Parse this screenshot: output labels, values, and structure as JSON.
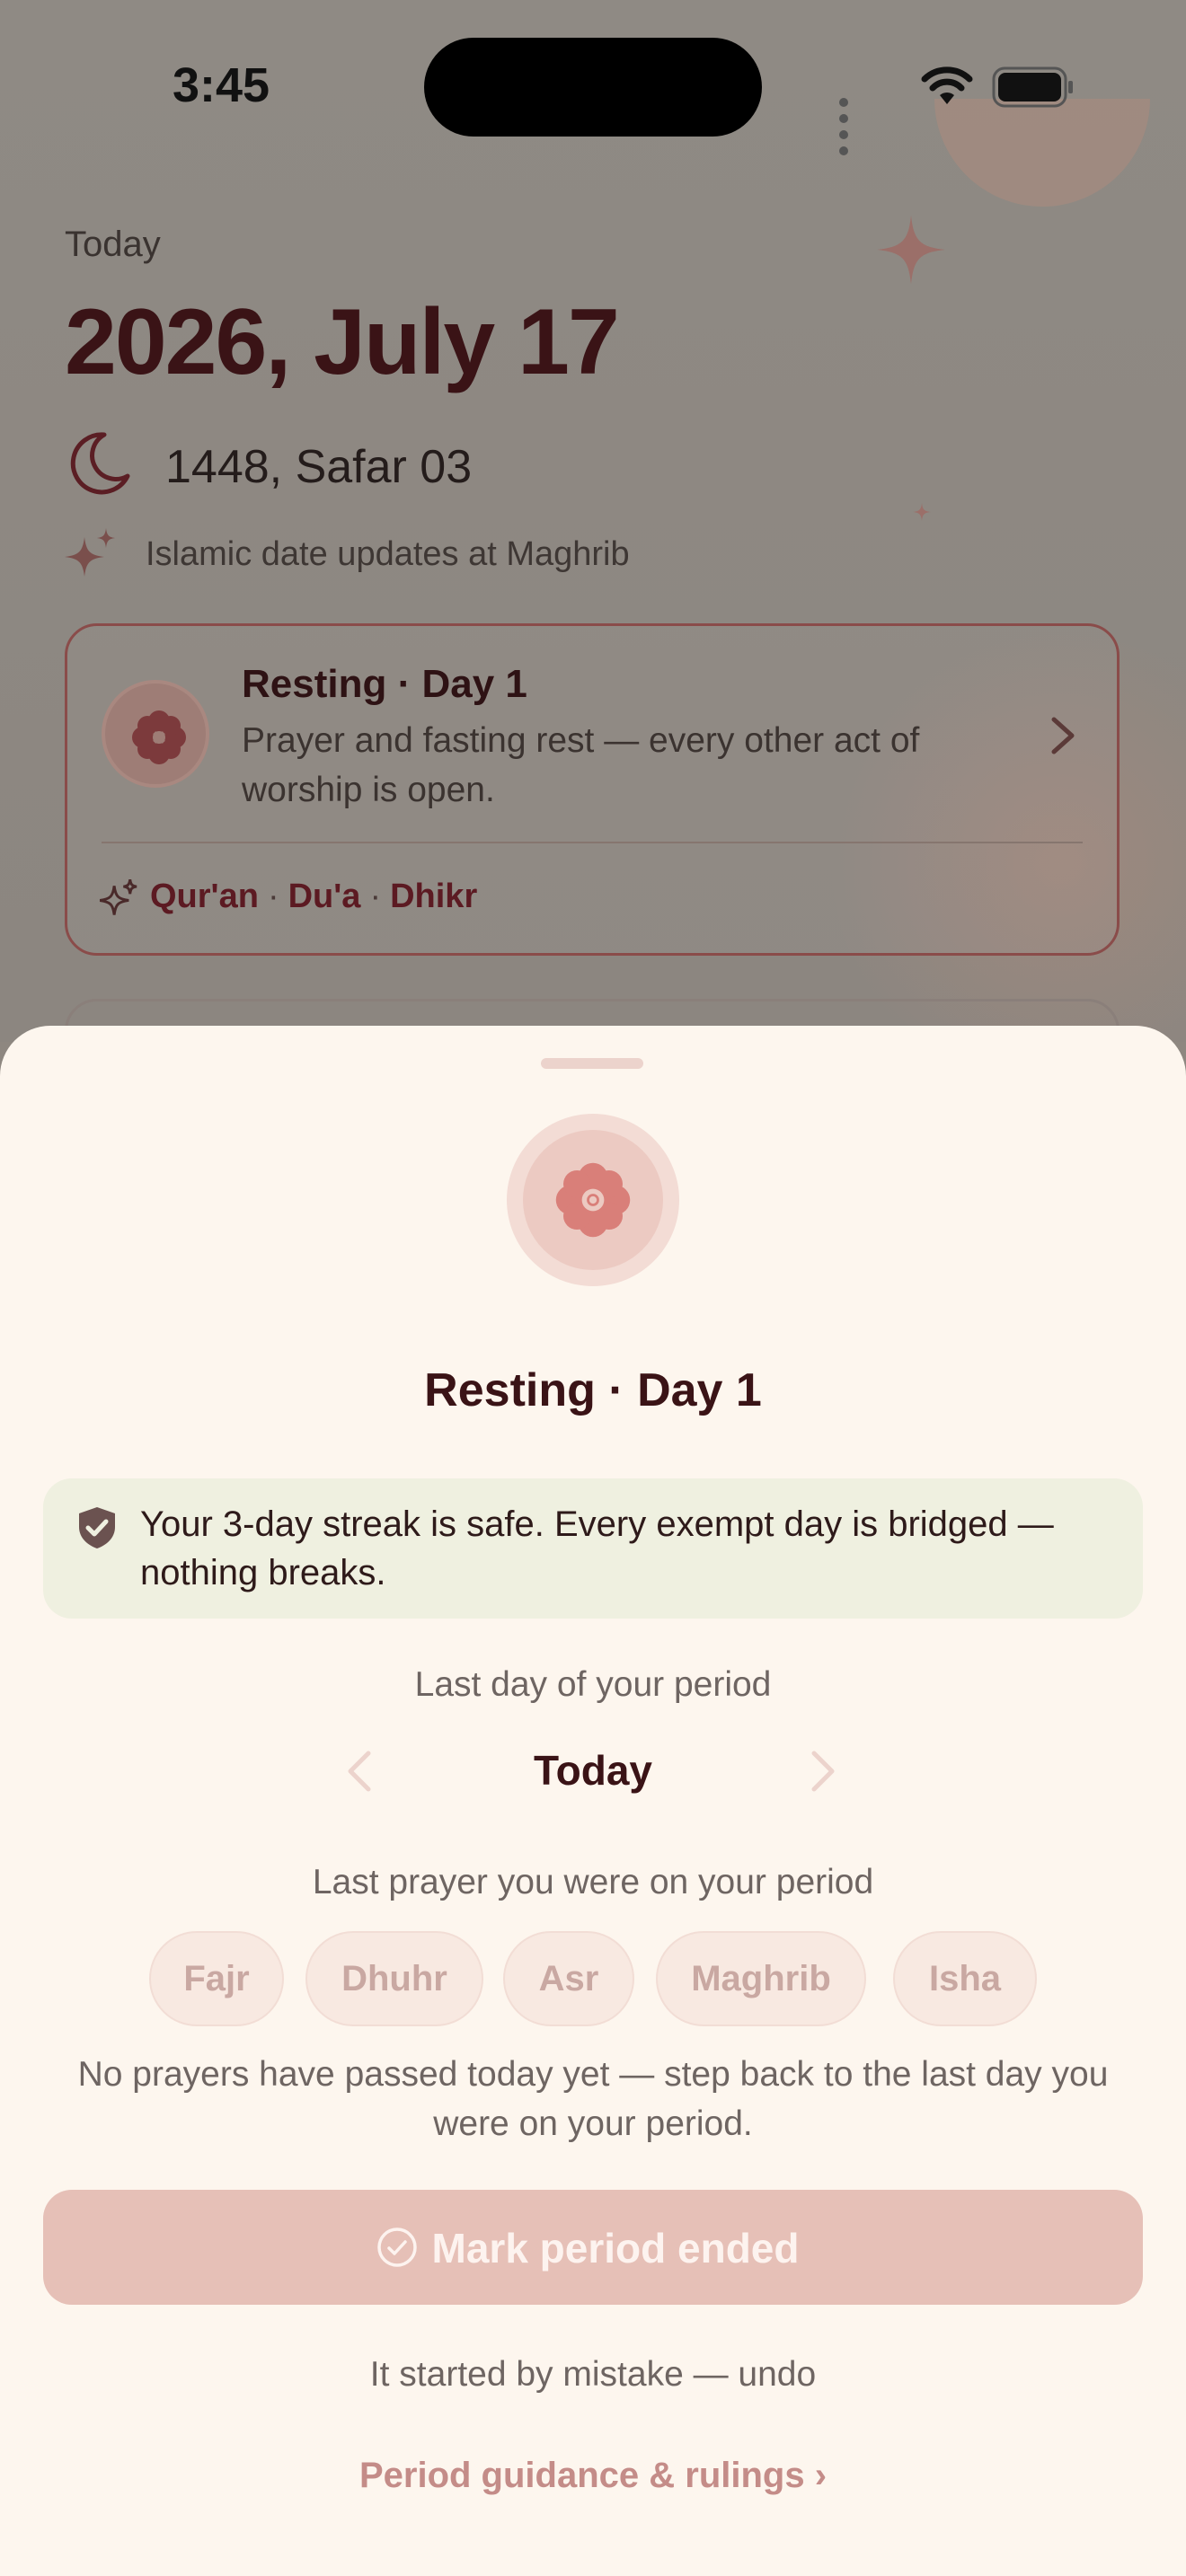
{
  "status_bar": {
    "time": "3:45"
  },
  "home": {
    "today_label": "Today",
    "gregorian_date": "2026, July 17",
    "hijri_date": "1448, Safar 03",
    "hijri_update_note": "Islamic date updates at Maghrib",
    "rest_card": {
      "title": "Resting · Day 1",
      "description": "Prayer and fasting rest — every other act of worship is open.",
      "acts": [
        "Qur'an",
        "Du'a",
        "Dhikr"
      ],
      "separator": "·"
    }
  },
  "sheet": {
    "title": "Resting · Day 1",
    "streak_message": "Your 3-day streak is safe. Every exempt day is bridged — nothing breaks.",
    "last_day_label": "Last day of your period",
    "selected_day": "Today",
    "last_prayer_label": "Last prayer you were on your period",
    "prayers": [
      "Fajr",
      "Dhuhr",
      "Asr",
      "Maghrib",
      "Isha"
    ],
    "no_prayers_note": "No prayers have passed today yet — step back to the last day you were on your period.",
    "mark_button_label": "Mark period ended",
    "undo_label": "It started by mistake — undo",
    "guidance_link": "Period guidance & rulings ›"
  },
  "colors": {
    "accent": "#3a1316",
    "sheet_background": "#fdf6ee",
    "streak_box": "#eff0e0",
    "button_disabled": "#e6c0b7",
    "link": "#c48c88"
  },
  "icons": [
    "moon-icon",
    "sparkle-icon",
    "flower-icon",
    "chevron-right-icon",
    "shield-check-icon",
    "chevron-left-icon",
    "check-circle-icon",
    "wifi-icon",
    "battery-icon"
  ]
}
